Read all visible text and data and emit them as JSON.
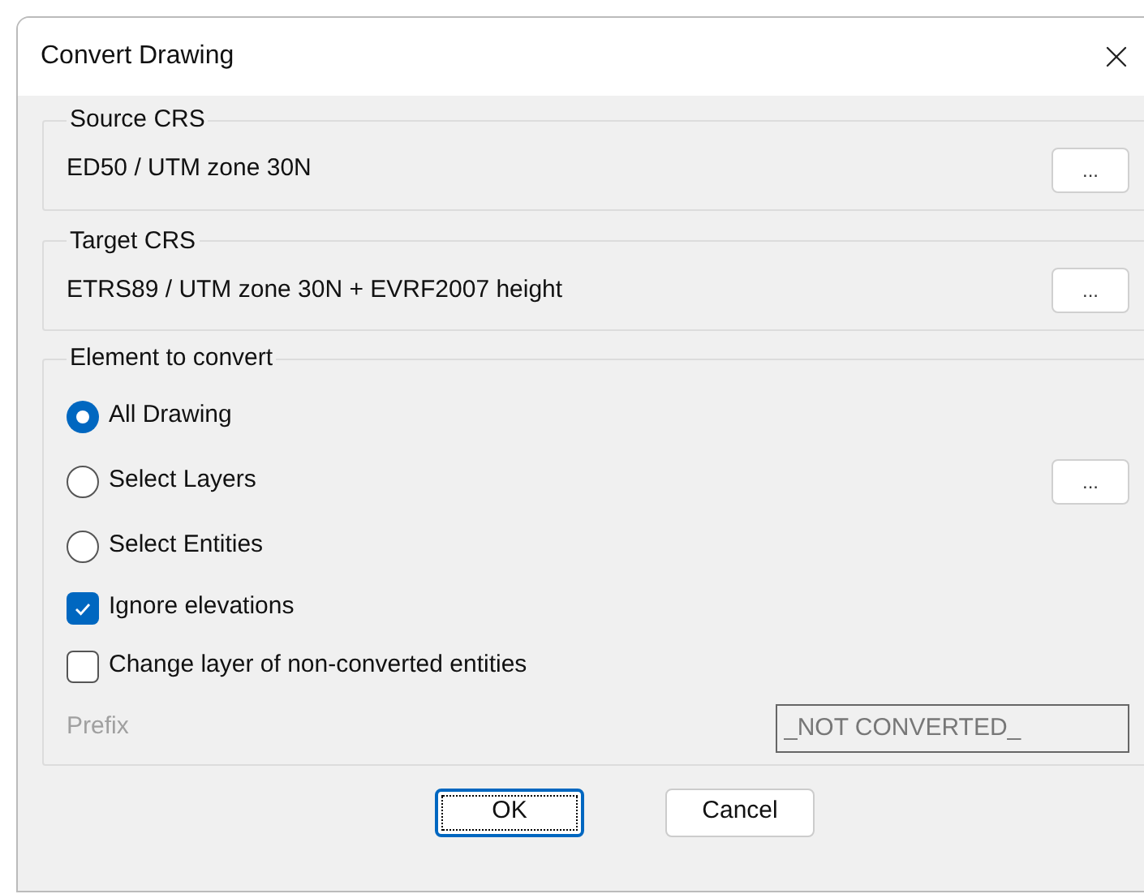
{
  "window": {
    "title": "Convert Drawing"
  },
  "source_crs": {
    "legend": "Source CRS",
    "value": "ED50 / UTM zone 30N",
    "browse": "..."
  },
  "target_crs": {
    "legend": "Target CRS",
    "value": "ETRS89 / UTM zone 30N + EVRF2007 height",
    "browse": "..."
  },
  "element_group": {
    "legend": "Element to convert",
    "options": [
      {
        "kind": "radio",
        "label": "All Drawing",
        "selected": true
      },
      {
        "kind": "radio",
        "label": "Select Layers",
        "selected": false,
        "browse": "..."
      },
      {
        "kind": "radio",
        "label": "Select Entities",
        "selected": false
      },
      {
        "kind": "checkbox",
        "label": "Ignore elevations",
        "checked": true
      },
      {
        "kind": "checkbox",
        "label": "Change layer of non-converted entities",
        "checked": false
      }
    ],
    "prefix": {
      "label": "Prefix",
      "value": "_NOT CONVERTED_",
      "disabled": true
    }
  },
  "buttons": [
    {
      "label": "OK",
      "focused": true
    },
    {
      "label": "Cancel",
      "focused": false
    }
  ]
}
